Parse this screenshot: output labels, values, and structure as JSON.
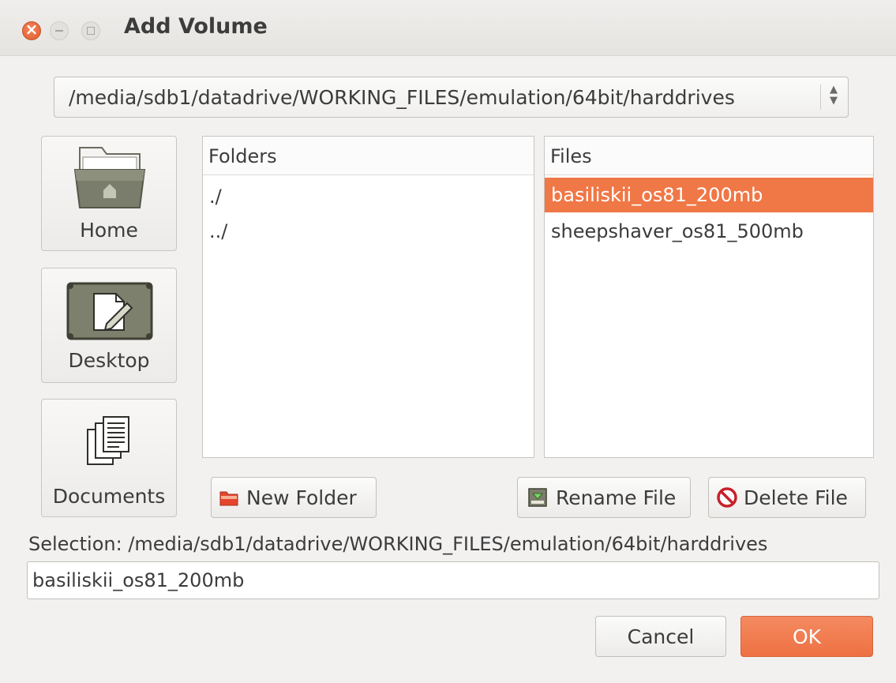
{
  "window": {
    "title": "Add Volume"
  },
  "path_combo": {
    "value": "/media/sdb1/datadrive/WORKING_FILES/emulation/64bit/harddrives"
  },
  "places": [
    {
      "label": "Home",
      "icon": "home-folder-icon"
    },
    {
      "label": "Desktop",
      "icon": "desktop-icon"
    },
    {
      "label": "Documents",
      "icon": "documents-icon"
    }
  ],
  "folders": {
    "header": "Folders",
    "items": [
      "./",
      "../"
    ]
  },
  "files": {
    "header": "Files",
    "items": [
      "basiliskii_os81_200mb",
      "sheepshaver_os81_500mb"
    ],
    "selected_index": 0
  },
  "buttons": {
    "new_folder": "New Folder",
    "rename_file": "Rename File",
    "delete_file": "Delete File",
    "cancel": "Cancel",
    "ok": "OK"
  },
  "selection": {
    "label": "Selection: /media/sdb1/datadrive/WORKING_FILES/emulation/64bit/harddrives",
    "value": "basiliskii_os81_200mb"
  },
  "colors": {
    "accent": "#f07746",
    "close_button": "#e05a2b"
  }
}
